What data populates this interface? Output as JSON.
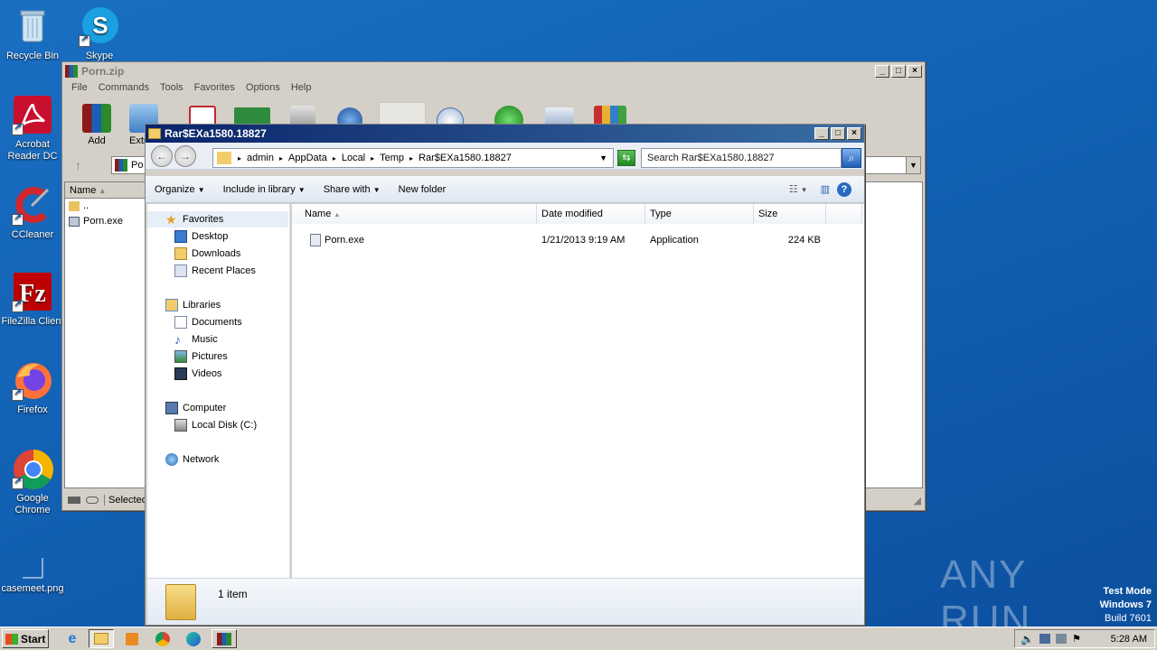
{
  "desktop": {
    "icons": [
      {
        "label": "Recycle Bin",
        "icon": "recycle-bin-icon"
      },
      {
        "label": "Skype",
        "icon": "skype-icon"
      },
      {
        "label": "Acrobat Reader DC",
        "icon": "acrobat-icon"
      },
      {
        "label": "CCleaner",
        "icon": "ccleaner-icon"
      },
      {
        "label": "FileZilla Client",
        "icon": "filezilla-icon"
      },
      {
        "label": "Firefox",
        "icon": "firefox-icon"
      },
      {
        "label": "Google Chrome",
        "icon": "chrome-icon"
      },
      {
        "label": "casemeet.png",
        "icon": "image-file-icon"
      }
    ],
    "watermark": "ANY RUN",
    "test_mode": {
      "line1": "Test Mode",
      "line2": "Windows 7",
      "line3": "Build 7601"
    }
  },
  "winrar": {
    "title": "Porn.zip",
    "menu": [
      "File",
      "Commands",
      "Tools",
      "Favorites",
      "Options",
      "Help"
    ],
    "toolbar": {
      "add": "Add",
      "extract": "Extr"
    },
    "path_text": "Po",
    "list_header": "Name",
    "list_items": [
      "..",
      "Porn.exe"
    ],
    "status": "Selected"
  },
  "explorer": {
    "title": "Rar$EXa1580.18827",
    "breadcrumb": [
      "admin",
      "AppData",
      "Local",
      "Temp",
      "Rar$EXa1580.18827"
    ],
    "search_placeholder": "Search Rar$EXa1580.18827",
    "commands": {
      "organize": "Organize",
      "include": "Include in library",
      "share": "Share with",
      "new_folder": "New folder"
    },
    "nav": {
      "favorites": "Favorites",
      "fav_items": [
        "Desktop",
        "Downloads",
        "Recent Places"
      ],
      "libraries": "Libraries",
      "lib_items": [
        "Documents",
        "Music",
        "Pictures",
        "Videos"
      ],
      "computer": "Computer",
      "comp_items": [
        "Local Disk (C:)"
      ],
      "network": "Network"
    },
    "columns": {
      "name": "Name",
      "date": "Date modified",
      "type": "Type",
      "size": "Size"
    },
    "files": [
      {
        "name": "Porn.exe",
        "date": "1/21/2013 9:19 AM",
        "type": "Application",
        "size": "224 KB"
      }
    ],
    "details": "1 item"
  },
  "taskbar": {
    "start": "Start",
    "clock": "5:28 AM"
  }
}
